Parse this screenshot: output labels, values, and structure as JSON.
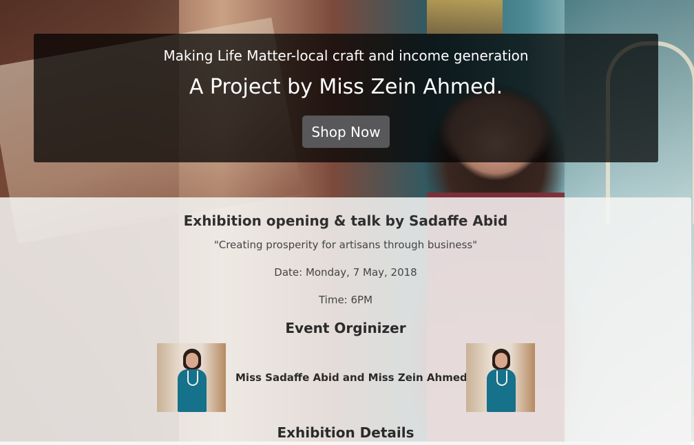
{
  "hero": {
    "tagline": "Making Life Matter-local craft and income generation",
    "title": "A Project by Miss Zein Ahmed.",
    "shop_button": "Shop Now"
  },
  "event": {
    "title": "Exhibition opening & talk by Sadaffe Abid",
    "quote": "\"Creating prosperity for artisans through business\"",
    "date": "Date: Monday, 7 May, 2018",
    "time": "Time: 6PM",
    "organizer_heading": "Event Orginizer",
    "organizers": "Miss Sadaffe Abid and Miss Zein Ahmed",
    "details_heading": "Exhibition Details"
  },
  "colors": {
    "overlay": "#000000",
    "button": "#58585a",
    "panel": "#f5f5f3"
  }
}
